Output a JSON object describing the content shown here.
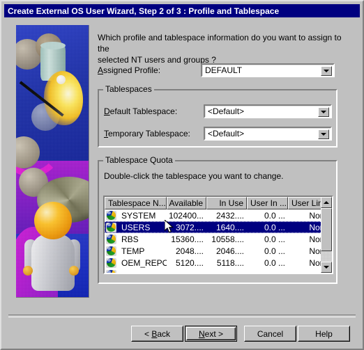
{
  "window": {
    "title": "Create External OS User Wizard, Step 2 of 3 : Profile and Tablespace"
  },
  "main": {
    "prompt_line1": "Which profile and tablespace information do you want to assign to the",
    "prompt_line2": "selected NT users and groups ?",
    "assigned_profile": {
      "label_accel": "A",
      "label_rest": "ssigned Profile:",
      "value": "DEFAULT"
    }
  },
  "tablespaces_group": {
    "title": "Tablespaces",
    "default_tablespace": {
      "label_accel": "D",
      "label_rest": "efault Tablespace:",
      "value": "<Default>"
    },
    "temporary_tablespace": {
      "label_accel": "T",
      "label_rest": "emporary Tablespace:",
      "value": "<Default>"
    }
  },
  "quota_group": {
    "title": "Tablespace Quota",
    "hint": "Double-click the tablespace you want to change.",
    "columns": [
      "Tablespace N...",
      "Available",
      "In Use",
      "User In ...",
      "User Limit"
    ],
    "rows": [
      {
        "name": "SYSTEM",
        "available": "102400...",
        "in_use": "2432....",
        "user_in": "0.0 ...",
        "user_limit": "None",
        "selected": false
      },
      {
        "name": "USERS",
        "available": "3072....",
        "in_use": "1640....",
        "user_in": "0.0 ...",
        "user_limit": "None",
        "selected": true
      },
      {
        "name": "RBS",
        "available": "15360....",
        "in_use": "10558....",
        "user_in": "0.0 ...",
        "user_limit": "None",
        "selected": false
      },
      {
        "name": "TEMP",
        "available": "2048....",
        "in_use": "2046....",
        "user_in": "0.0 ...",
        "user_limit": "None",
        "selected": false
      },
      {
        "name": "OEM_REPO...",
        "available": "5120....",
        "in_use": "5118....",
        "user_in": "0.0 ...",
        "user_limit": "None",
        "selected": false
      }
    ]
  },
  "buttons": {
    "back_pre": "< ",
    "back_accel": "B",
    "back_rest": "ack",
    "next_accel": "N",
    "next_rest": "ext >",
    "cancel": "Cancel",
    "help": "Help"
  },
  "colors": {
    "face": "#c0c0c0",
    "titlebar": "#000080",
    "selection": "#000080",
    "shadow": "#808080",
    "highlight": "#ffffff"
  }
}
